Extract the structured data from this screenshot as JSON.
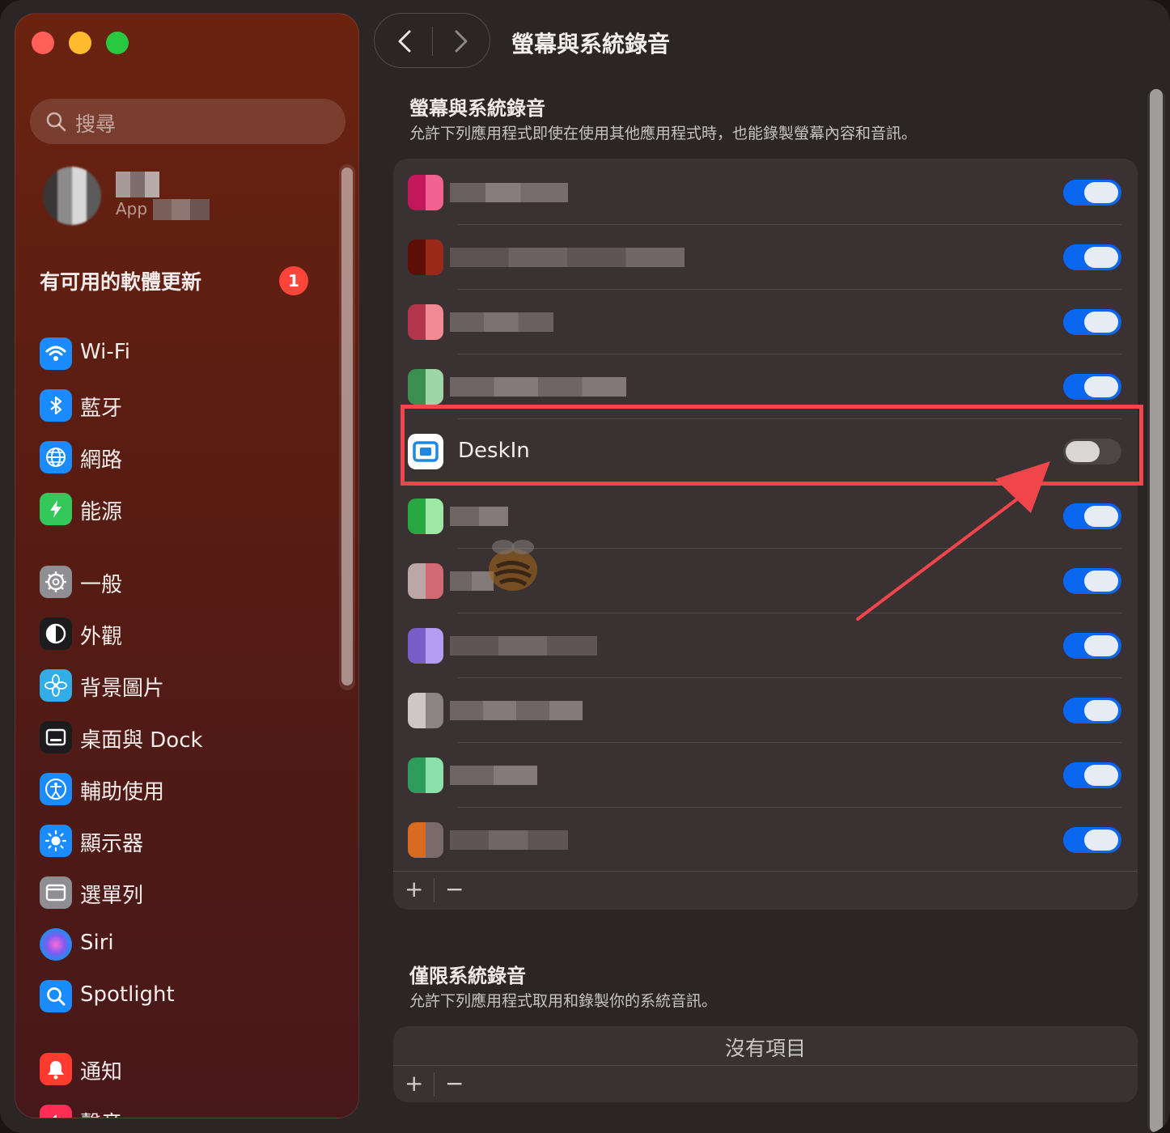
{
  "window": {
    "title": "螢幕與系統錄音"
  },
  "sidebar": {
    "search_placeholder": "搜尋",
    "profile_subtitle": "App",
    "update_label": "有可用的軟體更新",
    "update_count": "1",
    "items": [
      {
        "label": "Wi-Fi",
        "icon": "wifi-icon",
        "color": "#1a8cff"
      },
      {
        "label": "藍牙",
        "icon": "bluetooth-icon",
        "color": "#1a8cff"
      },
      {
        "label": "網路",
        "icon": "globe-icon",
        "color": "#1a8cff"
      },
      {
        "label": "能源",
        "icon": "bolt-icon",
        "color": "#34c759"
      },
      {
        "label": "一般",
        "icon": "gear-icon",
        "color": "#8e8e93"
      },
      {
        "label": "外觀",
        "icon": "appearance-icon",
        "color": "#1c1c1e"
      },
      {
        "label": "背景圖片",
        "icon": "flower-icon",
        "color": "#32ade6"
      },
      {
        "label": "桌面與 Dock",
        "icon": "dock-icon",
        "color": "#1c1c1e"
      },
      {
        "label": "輔助使用",
        "icon": "accessibility-icon",
        "color": "#1a8cff"
      },
      {
        "label": "顯示器",
        "icon": "sun-icon",
        "color": "#1a8cff"
      },
      {
        "label": "選單列",
        "icon": "menubar-icon",
        "color": "#8e8e93"
      },
      {
        "label": "Siri",
        "icon": "siri-icon",
        "color": "#3b2d6e"
      },
      {
        "label": "Spotlight",
        "icon": "magnifier-icon",
        "color": "#1a8cff"
      },
      {
        "label": "通知",
        "icon": "bell-icon",
        "color": "#ff3b30"
      },
      {
        "label": "聲音",
        "icon": "speaker-icon",
        "color": "#ff2d55"
      }
    ]
  },
  "main": {
    "screen_section": {
      "title": "螢幕與系統錄音",
      "description": "允許下列應用程式即使在使用其他應用程式時，也能錄製螢幕內容和音訊。",
      "apps": [
        {
          "name": "",
          "enabled": true,
          "icon_colors": [
            "#c2185b",
            "#f06292"
          ]
        },
        {
          "name": "",
          "enabled": true,
          "icon_colors": [
            "#5d0f06",
            "#9a2a18"
          ]
        },
        {
          "name": "",
          "enabled": true,
          "icon_colors": [
            "#b3364a",
            "#f08a94"
          ]
        },
        {
          "name": "",
          "enabled": true,
          "icon_colors": [
            "#3d8f4f",
            "#9fd6a8"
          ]
        },
        {
          "name": "DeskIn",
          "enabled": false,
          "icon_colors": [
            "#1e88e5",
            "#ffffff"
          ]
        },
        {
          "name": "",
          "enabled": true,
          "icon_colors": [
            "#27a842",
            "#9ee8a6"
          ]
        },
        {
          "name": "",
          "enabled": true,
          "icon_colors": [
            "#bba7a6",
            "#d06a75"
          ]
        },
        {
          "name": "",
          "enabled": true,
          "icon_colors": [
            "#7b5dc9",
            "#b59cf0"
          ]
        },
        {
          "name": "",
          "enabled": true,
          "icon_colors": [
            "#cfc7c7",
            "#8c8484"
          ]
        },
        {
          "name": "",
          "enabled": true,
          "icon_colors": [
            "#2e9c5b",
            "#8be0ab"
          ]
        },
        {
          "name": "",
          "enabled": true,
          "icon_colors": [
            "#d86b1f",
            "#7a6a69"
          ]
        }
      ],
      "add_label": "+",
      "remove_label": "−"
    },
    "audio_section": {
      "title": "僅限系統錄音",
      "description": "允許下列應用程式取用和錄製你的系統音訊。",
      "empty_text": "沒有項目",
      "add_label": "+",
      "remove_label": "−"
    }
  },
  "colors": {
    "accent": "#0a68f0",
    "highlight": "#f0464b"
  }
}
